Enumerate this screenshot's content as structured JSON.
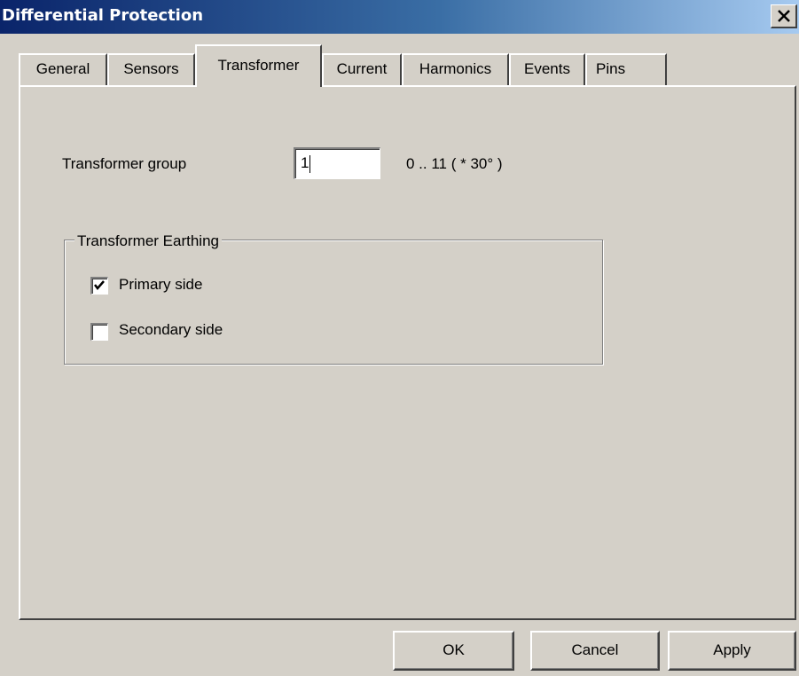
{
  "window": {
    "title": "Differential Protection",
    "close_icon": "close-icon"
  },
  "tabs": [
    {
      "label": "General",
      "active": false
    },
    {
      "label": "Sensors",
      "active": false
    },
    {
      "label": "Transformer",
      "active": true
    },
    {
      "label": "Current",
      "active": false
    },
    {
      "label": "Harmonics",
      "active": false
    },
    {
      "label": "Events",
      "active": false
    },
    {
      "label": "Pins",
      "active": false
    }
  ],
  "transformer": {
    "group_label": "Transformer group",
    "group_value": "1",
    "group_range": "0 .. 11  ( * 30° )",
    "earthing": {
      "legend": "Transformer Earthing",
      "primary_label": "Primary side",
      "primary_checked": true,
      "secondary_label": "Secondary side",
      "secondary_checked": false
    }
  },
  "buttons": {
    "ok": "OK",
    "cancel": "Cancel",
    "apply": "Apply"
  }
}
